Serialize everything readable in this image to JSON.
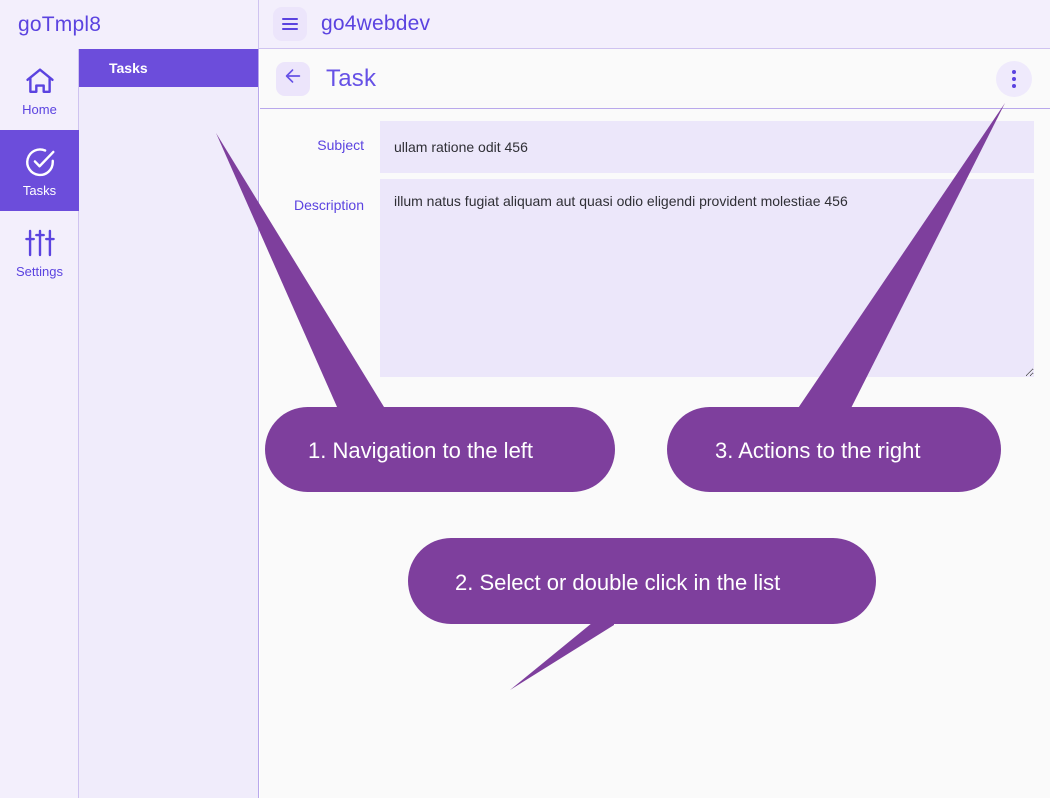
{
  "window": {
    "brand": "goTmpl8",
    "app_title": "go4webdev"
  },
  "icons": {
    "hamburger": "hamburger-menu-icon",
    "back": "arrow-left-icon",
    "kebab": "more-vertical-icon",
    "home": "home-icon",
    "tasks": "check-circle-icon",
    "settings": "sliders-icon"
  },
  "sidebar": {
    "items": [
      {
        "label": "Home",
        "icon": "home-icon",
        "active": false
      },
      {
        "label": "Tasks",
        "icon": "check-circle-icon",
        "active": true
      },
      {
        "label": "Settings",
        "icon": "sliders-icon",
        "active": false
      }
    ]
  },
  "list_panel": {
    "header": "Tasks",
    "rows": []
  },
  "page": {
    "title": "Task"
  },
  "form": {
    "fields": [
      {
        "label": "Subject",
        "value": "ullam ratione odit 456",
        "placeholder": "Subject",
        "type": "input"
      },
      {
        "label": "Description",
        "value": "illum natus fugiat aliquam aut quasi odio eligendi provident molestiae 456",
        "placeholder": "Description",
        "type": "textarea"
      }
    ]
  },
  "callouts": [
    {
      "id": 1,
      "text": "1. Navigation to the left"
    },
    {
      "id": 2,
      "text": "2. Select or double click in the list"
    },
    {
      "id": 3,
      "text": "3. Actions to the right"
    }
  ],
  "colors": {
    "brand_purple": "#5b43e0",
    "accent_purple": "#6c4ddb",
    "callout_purple": "#7e3f9d",
    "rail_bg": "#f3effc",
    "list_bg": "#f0ecfb",
    "main_bg": "#fafafa",
    "field_bg": "#ece7fa",
    "border": "#b9a8ec"
  }
}
